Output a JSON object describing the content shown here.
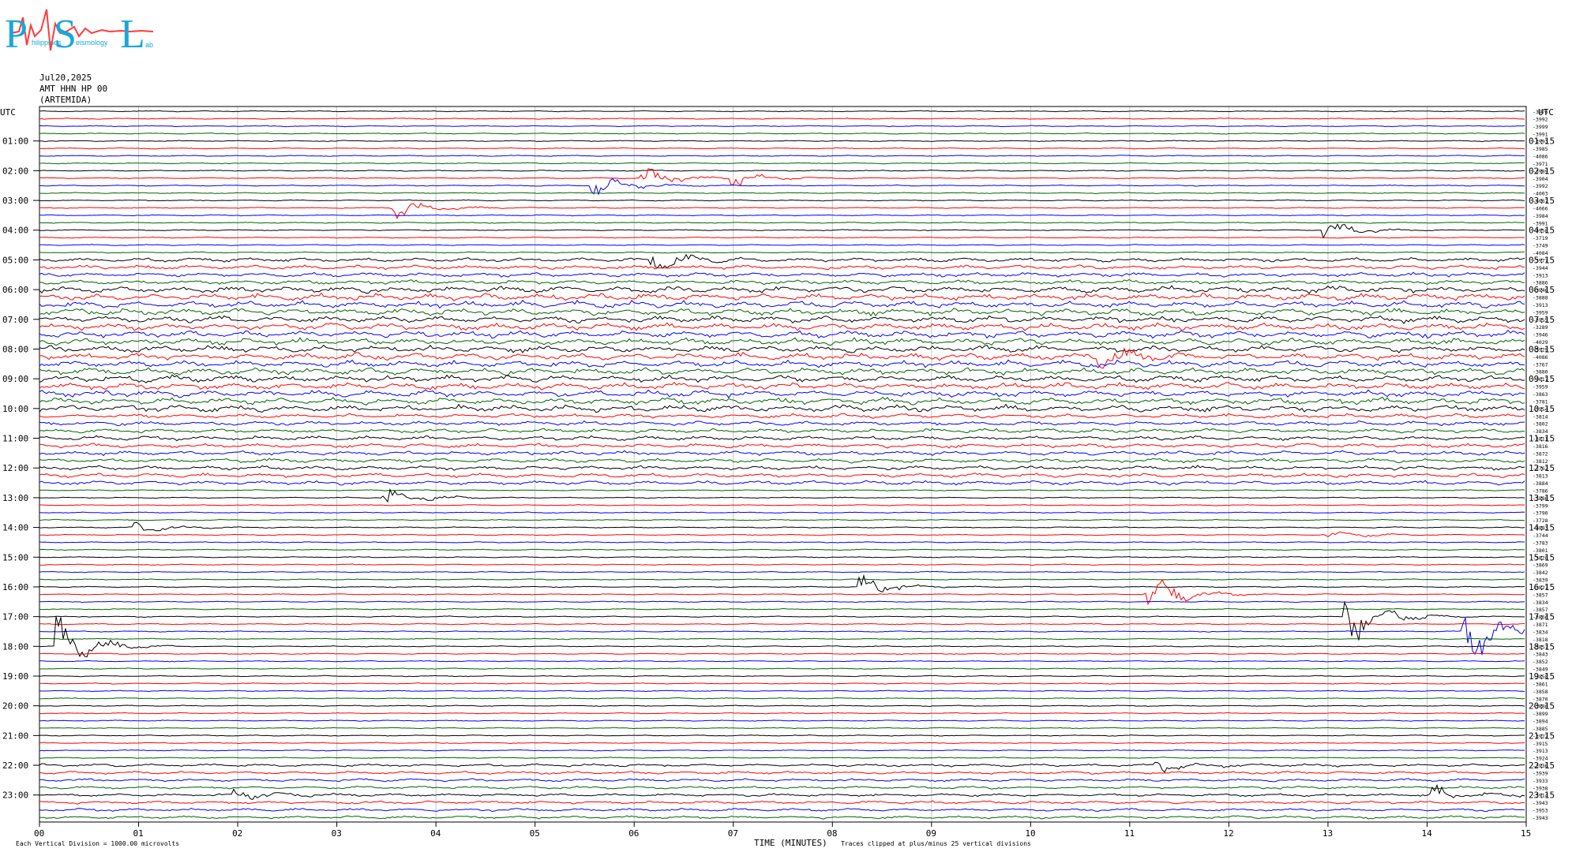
{
  "logo": {
    "letters": [
      "P",
      "S",
      "L"
    ],
    "small_text": [
      "hilippines",
      "eismology",
      "ab"
    ]
  },
  "header": {
    "date": "Jul20,2025",
    "channel": "AMT HHN HP 00",
    "station": "(ARTEMIDA)"
  },
  "chart_data": {
    "type": "line",
    "title": "",
    "xlabel": "TIME (MINUTES)",
    "ylabel": "UTC",
    "xlim": [
      0,
      15
    ],
    "x_ticks": [
      "00",
      "01",
      "02",
      "03",
      "04",
      "05",
      "06",
      "07",
      "08",
      "09",
      "10",
      "11",
      "12",
      "13",
      "14",
      "15"
    ],
    "left_axis_title": "UTC",
    "right_axis_title": "UTC",
    "left_hour_labels": [
      "01:00",
      "02:00",
      "03:00",
      "04:00",
      "05:00",
      "06:00",
      "07:00",
      "08:00",
      "09:00",
      "10:00",
      "11:00",
      "12:00",
      "13:00",
      "14:00",
      "15:00",
      "16:00",
      "17:00",
      "18:00",
      "19:00",
      "20:00",
      "21:00",
      "22:00",
      "23:00"
    ],
    "right_hour_labels": [
      "01:15",
      "02:15",
      "03:15",
      "04:15",
      "05:15",
      "06:15",
      "07:15",
      "08:15",
      "09:15",
      "10:15",
      "11:15",
      "12:15",
      "13:15",
      "14:15",
      "15:15",
      "16:15",
      "17:15",
      "18:15",
      "19:15",
      "20:15",
      "21:15",
      "22:15",
      "23:15"
    ],
    "trace_count": 96,
    "trace_color_cycle": [
      "#000000",
      "#ff0000",
      "#0000ff",
      "#006400"
    ],
    "right_trace_values": [
      -3976,
      -3992,
      -3999,
      -3991,
      -3993,
      -3985,
      -4086,
      -3971,
      -3989,
      -3904,
      -3992,
      -4003,
      -4067,
      -4066,
      -3984,
      -3991,
      -3958,
      -3719,
      -3749,
      -4084,
      -3977,
      -3944,
      -3913,
      -3886,
      -3946,
      -3888,
      -3913,
      -3959,
      -3955,
      -3289,
      -3946,
      -4029,
      -3929,
      -4086,
      -3767,
      -3880,
      -3617,
      -3959,
      -3863,
      -3781,
      -3954,
      -3814,
      -3802,
      -3834,
      -3811,
      -3816,
      -3872,
      -3812,
      -3762,
      -3813,
      -3884,
      -3786,
      -3886,
      -3799,
      -3790,
      -3728,
      -3883,
      -3744,
      -3783,
      -3801,
      -3820,
      -3869,
      -3842,
      -3839,
      -3827,
      -3857,
      -3834,
      -3857,
      -3866,
      -3871,
      -3834,
      -3818,
      -3857,
      -3843,
      -3852,
      -3849,
      -3858,
      -3861,
      -3858,
      -3870,
      -3880,
      -3899,
      -3894,
      -3885,
      -3922,
      -3915,
      -3913,
      -3924,
      -3936,
      -3939,
      -3933,
      -3938,
      -3914,
      -3943,
      -3953,
      -3943
    ],
    "footnote_left": "Each Vertical Division = 1000.00 microvolts",
    "footnote_right": "Traces clipped at plus/minus 25 vertical divisions",
    "grid": true,
    "events": [
      {
        "trace": 9,
        "minute": 6.1,
        "amp": 1.0
      },
      {
        "trace": 10,
        "minute": 5.6,
        "amp": 1.2
      },
      {
        "trace": 9,
        "minute": 7.0,
        "amp": 0.8
      },
      {
        "trace": 13,
        "minute": 3.6,
        "amp": 1.0
      },
      {
        "trace": 16,
        "minute": 13.0,
        "amp": 0.8
      },
      {
        "trace": 20,
        "minute": 6.2,
        "amp": 1.0
      },
      {
        "trace": 33,
        "minute": 10.7,
        "amp": 1.0
      },
      {
        "trace": 52,
        "minute": 3.5,
        "amp": 1.2
      },
      {
        "trace": 56,
        "minute": 1.0,
        "amp": 0.6
      },
      {
        "trace": 57,
        "minute": 13.0,
        "amp": 0.5
      },
      {
        "trace": 64,
        "minute": 8.3,
        "amp": 1.0
      },
      {
        "trace": 65,
        "minute": 11.2,
        "amp": 2.0
      },
      {
        "trace": 68,
        "minute": 13.2,
        "amp": 3.0
      },
      {
        "trace": 72,
        "minute": 0.2,
        "amp": 3.0
      },
      {
        "trace": 70,
        "minute": 14.4,
        "amp": 3.5
      },
      {
        "trace": 88,
        "minute": 11.3,
        "amp": 0.8
      },
      {
        "trace": 92,
        "minute": 14.1,
        "amp": 0.8
      },
      {
        "trace": 92,
        "minute": 2.0,
        "amp": 0.6
      }
    ]
  }
}
